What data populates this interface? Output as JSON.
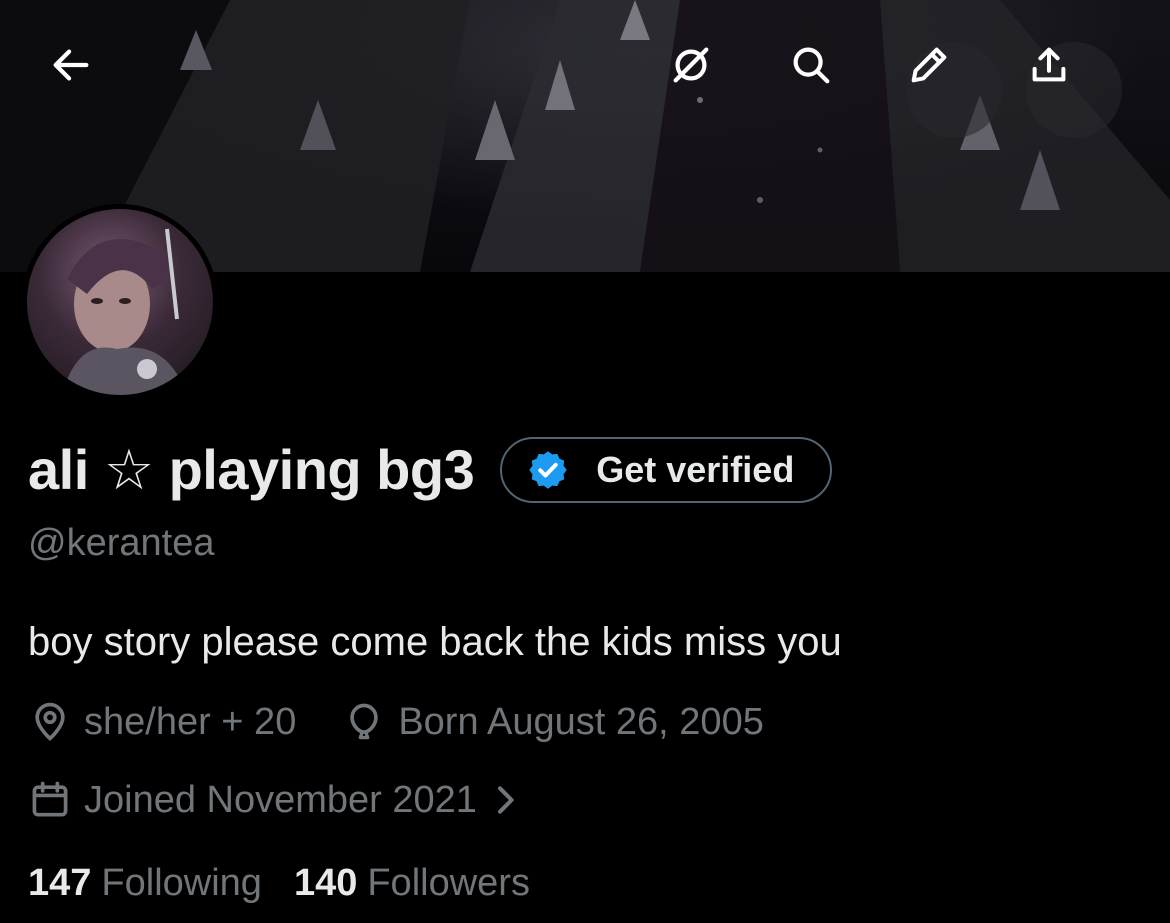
{
  "profile": {
    "display_name": "ali ☆ playing bg3",
    "handle": "@kerantea",
    "bio": "boy story please come back the kids miss you",
    "pronouns": "she/her + 20",
    "birthday": "Born August 26, 2005",
    "joined": "Joined November 2021",
    "following_count": "147",
    "following_label": "Following",
    "followers_count": "140",
    "followers_label": "Followers"
  },
  "header": {
    "verify_label": "Get verified"
  },
  "icons": {
    "back": "arrow-left-icon",
    "grok": "grok-icon",
    "search": "search-icon",
    "edit": "pencil-icon",
    "share": "share-icon",
    "verified": "verified-badge-icon",
    "location": "location-pin-icon",
    "birthday": "balloon-icon",
    "calendar": "calendar-icon",
    "chevron": "chevron-right-icon"
  },
  "colors": {
    "background": "#000000",
    "primary_text": "#e7e9ea",
    "secondary_text": "#71767b",
    "verified_blue": "#1d9bf0",
    "border": "#536471"
  }
}
